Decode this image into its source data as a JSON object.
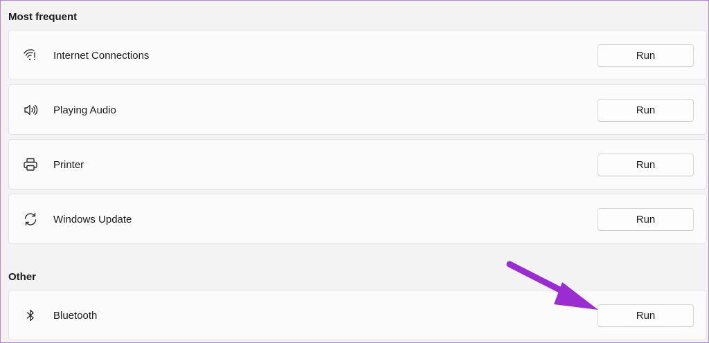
{
  "sections": [
    {
      "title": "Most frequent",
      "items": [
        {
          "label": "Internet Connections",
          "icon": "wifi-icon",
          "button": "Run"
        },
        {
          "label": "Playing Audio",
          "icon": "speaker-icon",
          "button": "Run"
        },
        {
          "label": "Printer",
          "icon": "printer-icon",
          "button": "Run"
        },
        {
          "label": "Windows Update",
          "icon": "sync-icon",
          "button": "Run"
        }
      ]
    },
    {
      "title": "Other",
      "items": [
        {
          "label": "Bluetooth",
          "icon": "bluetooth-icon",
          "button": "Run"
        }
      ]
    }
  ],
  "colors": {
    "background": "#f3f3f3",
    "card": "#fbfbfb",
    "annotation_arrow": "#9b2cd1"
  }
}
